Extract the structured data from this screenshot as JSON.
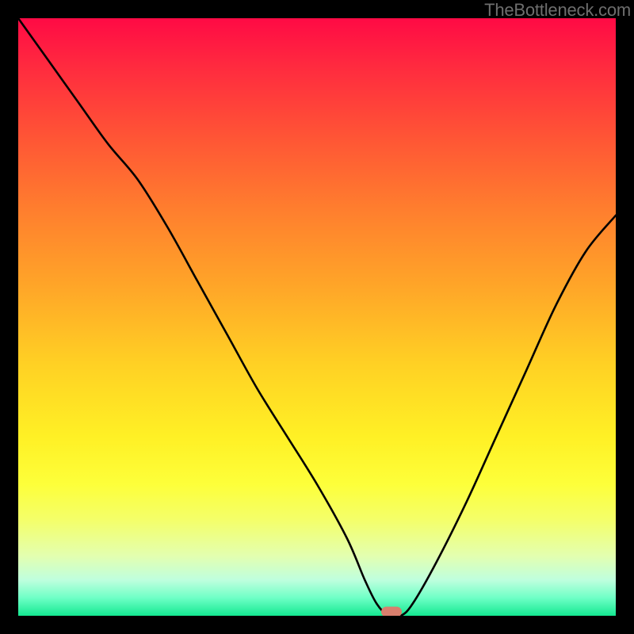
{
  "credits": "TheBottleneck.com",
  "marker": {
    "x_pct": 62.5,
    "y_pct": 99.35
  },
  "chart_data": {
    "type": "line",
    "title": "",
    "xlabel": "",
    "ylabel": "",
    "xlim": [
      0,
      100
    ],
    "ylim": [
      0,
      100
    ],
    "series": [
      {
        "name": "bottleneck-curve",
        "x": [
          0,
          5,
          10,
          15,
          20,
          25,
          30,
          35,
          40,
          45,
          50,
          55,
          58,
          60,
          62,
          64,
          66,
          70,
          75,
          80,
          85,
          90,
          95,
          100
        ],
        "y": [
          100,
          93,
          86,
          79,
          73,
          65,
          56,
          47,
          38,
          30,
          22,
          13,
          6,
          2,
          0,
          0,
          2,
          9,
          19,
          30,
          41,
          52,
          61,
          67
        ]
      }
    ],
    "marker": {
      "x": 62.5,
      "y": 0.5
    },
    "background_gradient": {
      "stops": [
        {
          "pct": 0,
          "color": "#ff0a45"
        },
        {
          "pct": 20,
          "color": "#ff5535"
        },
        {
          "pct": 45,
          "color": "#ffa628"
        },
        {
          "pct": 70,
          "color": "#fff025"
        },
        {
          "pct": 90,
          "color": "#e3ffb0"
        },
        {
          "pct": 100,
          "color": "#14e991"
        }
      ]
    }
  }
}
